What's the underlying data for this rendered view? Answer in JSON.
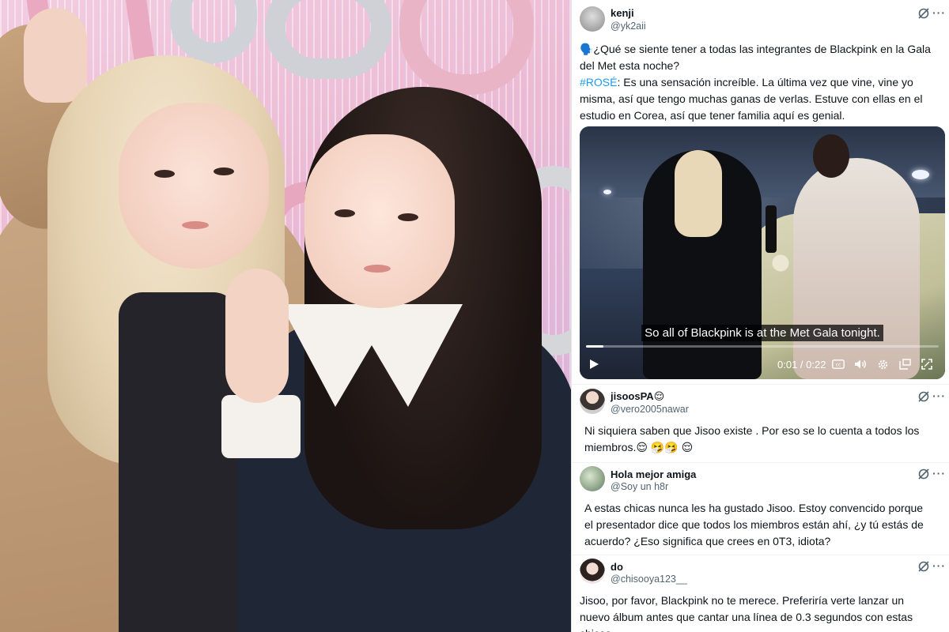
{
  "post": {
    "author_name": "kenji",
    "author_handle": "@yk2aii",
    "text_question": "🗣️¿Qué se siente tener a todas las integrantes de Blackpink en la Gala del Met esta noche?",
    "hashtag": "#ROSÉ",
    "text_answer": ": Es una sensación increíble. La última vez que vine, vine yo misma, así que tengo muchas ganas de verlas. Estuve con ellas en el estudio en Corea, así que tener familia aquí es genial.",
    "video": {
      "caption": "So all of Blackpink is at the Met Gala tonight.",
      "time_current": "0:01",
      "time_total": "0:22",
      "progress": 0.05
    }
  },
  "replies": [
    {
      "name": "jisoosPA😌",
      "handle": "@vero2005nawar",
      "text": "Ni siquiera saben que Jisoo existe . Por eso se lo cuenta a todos los miembros.😌 🤧🤧 😌"
    },
    {
      "name": "Hola mejor amiga",
      "handle": "@Soy un h8r",
      "text": "A estas chicas nunca les ha gustado Jisoo. Estoy convencido porque el presentador dice que todos los miembros están ahí, ¿y tú estás de acuerdo? ¿Eso significa que crees en 0T3, idiota?"
    },
    {
      "name": "do",
      "handle": "@chisooya123__",
      "text": "Jisoo, por favor, Blackpink no te merece. Preferiría verte lanzar un nuevo álbum antes que cantar una línea de 0.3 segundos con estas chicas."
    }
  ],
  "icons": {
    "grok": "grok-icon",
    "more": "more-icon",
    "play": "play-icon",
    "captions": "captions-icon",
    "volume": "volume-icon",
    "settings": "gear-icon",
    "pip": "picture-in-picture-icon",
    "fullscreen": "fullscreen-icon"
  },
  "colors": {
    "link": "#1d9bf0",
    "secondary_text": "#536471",
    "divider": "#eff3f4"
  }
}
